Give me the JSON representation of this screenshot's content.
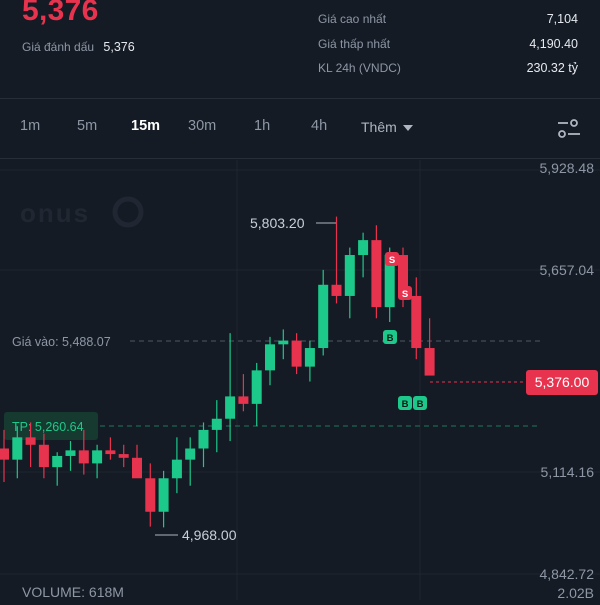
{
  "header": {
    "last_price": "5,376",
    "mark_price_label": "Giá đánh dấu",
    "mark_price_value": "5,376",
    "stats": [
      {
        "label": "Giá cao nhất",
        "value": "7,104"
      },
      {
        "label": "Giá thấp nhất",
        "value": "4,190.40"
      },
      {
        "label": "KL 24h (VNDC)",
        "value": "230.32 tỷ"
      }
    ]
  },
  "intervals": {
    "items": [
      "1m",
      "5m",
      "15m",
      "30m",
      "1h",
      "4h"
    ],
    "active": "15m",
    "more_label": "Thêm"
  },
  "chart": {
    "watermark": "onus",
    "price_axis_labels": [
      "5,928.48",
      "5,657.04",
      "5,114.16",
      "4,842.72"
    ],
    "current_price_tag": "5,376.00",
    "entry_line_label": "Giá vào: 5,488.07",
    "tp_line_label": "TP: 5,260.64",
    "high_annotation": "5,803.20",
    "low_annotation": "4,968.00",
    "volume_label": "VOLUME: 618M",
    "volume_axis_label": "2.02B",
    "marker_sell": "S",
    "marker_buy": "B",
    "colors": {
      "up": "#1dc98a",
      "down": "#e8334f",
      "background": "#151b24",
      "grid": "#1f2631"
    }
  },
  "chart_data": {
    "type": "candlestick",
    "price_range": [
      4842.72,
      5928.48
    ],
    "candles": [
      {
        "o": 5180,
        "h": 5230,
        "l": 5090,
        "c": 5150
      },
      {
        "o": 5150,
        "h": 5240,
        "l": 5100,
        "c": 5210
      },
      {
        "o": 5210,
        "h": 5250,
        "l": 5130,
        "c": 5190
      },
      {
        "o": 5190,
        "h": 5220,
        "l": 5100,
        "c": 5130
      },
      {
        "o": 5130,
        "h": 5170,
        "l": 5080,
        "c": 5160
      },
      {
        "o": 5160,
        "h": 5200,
        "l": 5120,
        "c": 5175
      },
      {
        "o": 5175,
        "h": 5230,
        "l": 5110,
        "c": 5140
      },
      {
        "o": 5140,
        "h": 5190,
        "l": 5100,
        "c": 5175
      },
      {
        "o": 5175,
        "h": 5210,
        "l": 5150,
        "c": 5165
      },
      {
        "o": 5165,
        "h": 5190,
        "l": 5130,
        "c": 5155
      },
      {
        "o": 5155,
        "h": 5190,
        "l": 5120,
        "c": 5100
      },
      {
        "o": 5100,
        "h": 5140,
        "l": 4970,
        "c": 5010
      },
      {
        "o": 5010,
        "h": 5120,
        "l": 4968,
        "c": 5100
      },
      {
        "o": 5100,
        "h": 5210,
        "l": 5060,
        "c": 5150
      },
      {
        "o": 5150,
        "h": 5210,
        "l": 5080,
        "c": 5180
      },
      {
        "o": 5180,
        "h": 5250,
        "l": 5130,
        "c": 5230
      },
      {
        "o": 5230,
        "h": 5310,
        "l": 5170,
        "c": 5260
      },
      {
        "o": 5260,
        "h": 5490,
        "l": 5200,
        "c": 5320
      },
      {
        "o": 5320,
        "h": 5380,
        "l": 5280,
        "c": 5300
      },
      {
        "o": 5300,
        "h": 5410,
        "l": 5240,
        "c": 5390
      },
      {
        "o": 5390,
        "h": 5480,
        "l": 5350,
        "c": 5460
      },
      {
        "o": 5460,
        "h": 5500,
        "l": 5420,
        "c": 5470
      },
      {
        "o": 5470,
        "h": 5490,
        "l": 5380,
        "c": 5400
      },
      {
        "o": 5400,
        "h": 5470,
        "l": 5360,
        "c": 5450
      },
      {
        "o": 5450,
        "h": 5660,
        "l": 5430,
        "c": 5620
      },
      {
        "o": 5620,
        "h": 5803.2,
        "l": 5570,
        "c": 5590
      },
      {
        "o": 5590,
        "h": 5720,
        "l": 5530,
        "c": 5700
      },
      {
        "o": 5700,
        "h": 5760,
        "l": 5640,
        "c": 5740
      },
      {
        "o": 5740,
        "h": 5780,
        "l": 5530,
        "c": 5560
      },
      {
        "o": 5560,
        "h": 5720,
        "l": 5520,
        "c": 5700
      },
      {
        "o": 5700,
        "h": 5720,
        "l": 5560,
        "c": 5590
      },
      {
        "o": 5590,
        "h": 5640,
        "l": 5420,
        "c": 5450
      },
      {
        "o": 5450,
        "h": 5530,
        "l": 5380,
        "c": 5376
      }
    ]
  }
}
